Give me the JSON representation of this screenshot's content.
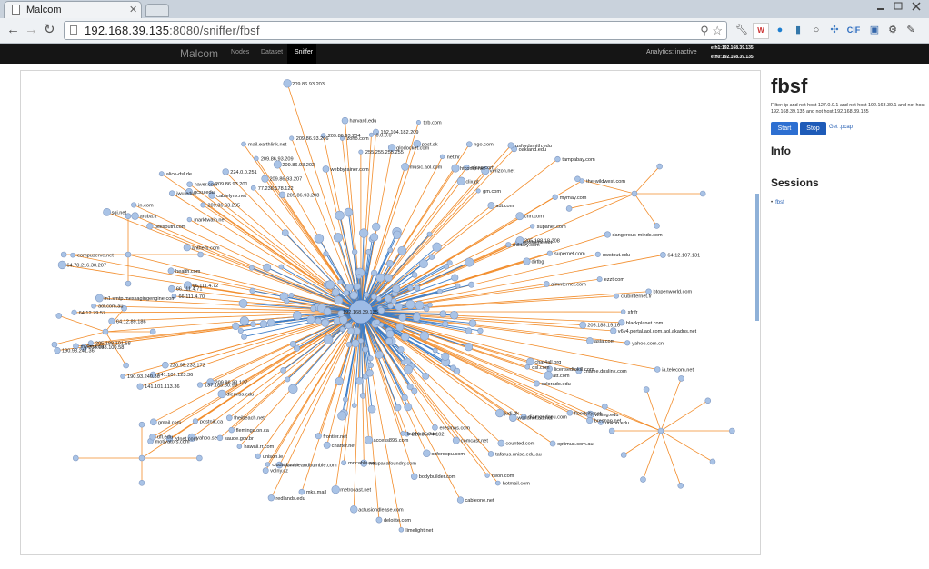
{
  "browser": {
    "tab_title": "Malcom",
    "url_host": "192.168.39.135",
    "url_rest": ":8080/sniffer/fbsf"
  },
  "appnav": {
    "brand": "Malcom",
    "links": [
      "Nodes",
      "Dataset",
      "Sniffer"
    ],
    "active": "Sniffer",
    "analytics": "Analytics: inactive",
    "interfaces": [
      "eth1:192.168.39.135",
      "eth0:192.168.39.135"
    ]
  },
  "session": {
    "name": "fbsf",
    "filter": "Filter: ip and not host 127.0.0.1 and not host 192.168.39.1 and not host 192.168.39.135 and not host 192.168.39.135",
    "start_label": "Start",
    "stop_label": "Stop",
    "pcap_label": "Get .pcap",
    "info_heading": "Info",
    "sessions_heading": "Sessions",
    "sessions": [
      "fbsf"
    ]
  },
  "graph": {
    "hub_label": "192.168.39.135",
    "node_labels": [
      "255.255.255.255",
      "0.0.0.0",
      "192.104.182.209",
      "glodocket.com",
      "music.aol.com",
      "post.sk",
      "net.hr",
      "ttrb.com",
      "clix.pt",
      "plaxo.com",
      "htcomp.net",
      "ngo.com",
      "verizon.net",
      "gm.com",
      "oakland.edu",
      "tampabay.com",
      "adt.com",
      "usfordsmith.edu",
      "cnn.com",
      "mymay.com",
      "supanet.com",
      "the-wildwest.com",
      "optonline.net",
      "dangerous-minds.com",
      "supernet.com",
      "uwstout.edu",
      "military.com",
      "205.188.18.208",
      "64.12.107.131",
      "dirtbg",
      "aimnternet.com",
      "ezzt.com",
      "btopenworld.com",
      "clubinternet.fr",
      "sfr.fr",
      "blackplanet.com",
      "205.188.19.16",
      "v6v4.portal.aol.com.aol.akadns.net",
      "asia.com",
      "yahoo.com.cn",
      "chat4all.org",
      "dsl.com",
      "ia.telecom.net",
      "cname.dnslink.com",
      "colorado.edu",
      "licensedtokill.com",
      "willing.edu",
      "att.com",
      "worldnet.att.net",
      "floodcity.net",
      "unkon.edu",
      "judi.dk",
      "bresnan.net",
      "optimus.com.au",
      "diamondcpu.com",
      "counted.com",
      "rwon.com",
      "tafarus.unisa.edu.au",
      "hotmail.com",
      "comcast.net",
      "eresmas.com",
      "cableone.net",
      "bodybuilder.com",
      "oxfordcpu.com",
      "bushnet.com",
      "216.35.74.102",
      "limelight.net",
      "deloitte.com",
      "access895.com",
      "waupacafoundry.com",
      "actusiondlease.com",
      "mncable.net",
      "metrocast.net",
      "charter.net",
      "frontier.net",
      "mks.mail",
      "volny.cz",
      "cludad.com",
      "unison.ie",
      "redlands.edu",
      "bumbleandbumble.com",
      "hawaii.rr.com",
      "theibeach.net",
      "postnik.ca",
      "saude.gov.br",
      "motivators.com",
      "ufl.edu",
      "flemingc.on.ca",
      "diemiss.edu",
      "yahoo.se",
      "zdnet.com",
      "gmail.com",
      "209.86.93.127",
      "137.188.80.99",
      "220.95.233.172",
      "141.101.113.36",
      "190.93.240.36",
      "141.101.123.36",
      "190.93.241.36",
      "myllm.edu",
      "205.188.100.58",
      "205.188.101.58",
      "64.12.89.186",
      "64.12.79.57",
      "aol.com.au",
      "in1.smtp.messagingengine.com",
      "66.111.4.70",
      "66.111.4.71",
      "66.111.4.72",
      "health.com",
      "64.70.216.30.207",
      "compuserve.net",
      "anthem.com",
      "aruba.it",
      "sgi.net",
      "in.com",
      "jwu.edu",
      "bellsouth.com",
      "gcsu.edu",
      "alice-dsl.de",
      "224.0.0.251",
      "marktwain.net",
      "cablelynx.net",
      "naver.com",
      "77.238.178.122",
      "mail.earthlink.net",
      "209.86.93.201",
      "209.86.93.205",
      "209.86.93.209",
      "209.86.93.202",
      "209.86.93.207",
      "209.86.93.203",
      "209.86.93.208",
      "209.86.93.206",
      "209.86.93.204",
      "webbyrainer.com",
      "harvard.edu",
      "zoho.com"
    ]
  }
}
